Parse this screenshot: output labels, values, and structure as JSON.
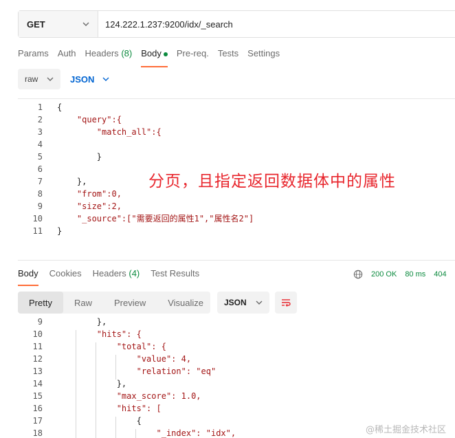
{
  "request": {
    "method": "GET",
    "url": "124.222.1.237:9200/idx/_search",
    "tabs": [
      {
        "label": "Params"
      },
      {
        "label": "Auth"
      },
      {
        "label": "Headers",
        "count": "(8)"
      },
      {
        "label": "Body"
      },
      {
        "label": "Pre-req."
      },
      {
        "label": "Tests"
      },
      {
        "label": "Settings"
      }
    ],
    "body_mode": "raw",
    "body_format": "JSON"
  },
  "editor_lines": [
    {
      "n": "1",
      "t": "{"
    },
    {
      "n": "2",
      "t": "    \"query\":{"
    },
    {
      "n": "3",
      "t": "        \"match_all\":{"
    },
    {
      "n": "4",
      "t": ""
    },
    {
      "n": "5",
      "t": "        }"
    },
    {
      "n": "6",
      "t": ""
    },
    {
      "n": "7",
      "t": "    },"
    },
    {
      "n": "8",
      "t": "    \"from\":0,"
    },
    {
      "n": "9",
      "t": "    \"size\":2,"
    },
    {
      "n": "10",
      "t": "    \"_source\":[\"需要返回的属性1\",\"属性名2\"]"
    },
    {
      "n": "11",
      "t": "}"
    }
  ],
  "annotation": "分页，且指定返回数据体中的属性",
  "response": {
    "tabs": [
      {
        "label": "Body"
      },
      {
        "label": "Cookies"
      },
      {
        "label": "Headers",
        "count": "(4)"
      },
      {
        "label": "Test Results"
      }
    ],
    "status": "200 OK",
    "time": "80 ms",
    "size": "404",
    "view_options": [
      "Pretty",
      "Raw",
      "Preview",
      "Visualize"
    ],
    "format": "JSON",
    "lines": [
      {
        "n": "9",
        "t": "        },"
      },
      {
        "n": "10",
        "t": "        \"hits\": {"
      },
      {
        "n": "11",
        "t": "            \"total\": {"
      },
      {
        "n": "12",
        "t": "                \"value\": 4,"
      },
      {
        "n": "13",
        "t": "                \"relation\": \"eq\""
      },
      {
        "n": "14",
        "t": "            },"
      },
      {
        "n": "15",
        "t": "            \"max_score\": 1.0,"
      },
      {
        "n": "16",
        "t": "            \"hits\": ["
      },
      {
        "n": "17",
        "t": "                {"
      },
      {
        "n": "18",
        "t": "                    \"_index\": \"idx\","
      }
    ]
  },
  "watermark": "@稀土掘金技术社区",
  "colors": {
    "accent": "#ff6c37",
    "success": "#0b8a3e",
    "link": "#0265d2",
    "annotation": "#e8262d"
  }
}
